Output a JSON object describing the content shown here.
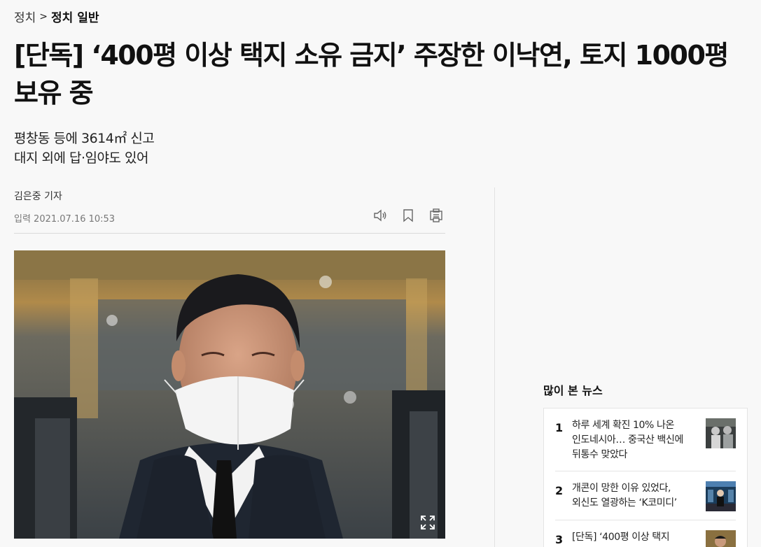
{
  "breadcrumb": {
    "section": "정치",
    "separator": ">",
    "subsection": "정치 일반"
  },
  "article": {
    "headline_line1": "[단독] ‘400평 이상 택지 소유 금지’ 주장한 이낙연, 토지 1000평",
    "headline_line2": "보유 중",
    "subheadline_line1": "평창동 등에 3614㎡ 신고",
    "subheadline_line2": "대지 외에 답·임야도 있어",
    "byline": "김은중 기자",
    "published": "입력 2021.07.16 10:53"
  },
  "tools": [
    {
      "name": "listen-icon"
    },
    {
      "name": "bookmark-icon"
    },
    {
      "name": "print-icon"
    }
  ],
  "photo": {
    "icon": "expand-icon"
  },
  "popular": {
    "title": "많이 본 뉴스",
    "items": [
      {
        "rank": "1",
        "line1": "하루 세계 확진 10% 나온",
        "line2": "인도네시아… 중국산 백신에",
        "line3": "뒤통수 맞았다"
      },
      {
        "rank": "2",
        "line1": "개콘이 망한 이유 있었다,",
        "line2": "외신도 열광하는 ‘K코미디’",
        "line3": ""
      },
      {
        "rank": "3",
        "line1": "[단독] ‘400평 이상 택지",
        "line2": "",
        "line3": ""
      }
    ]
  }
}
